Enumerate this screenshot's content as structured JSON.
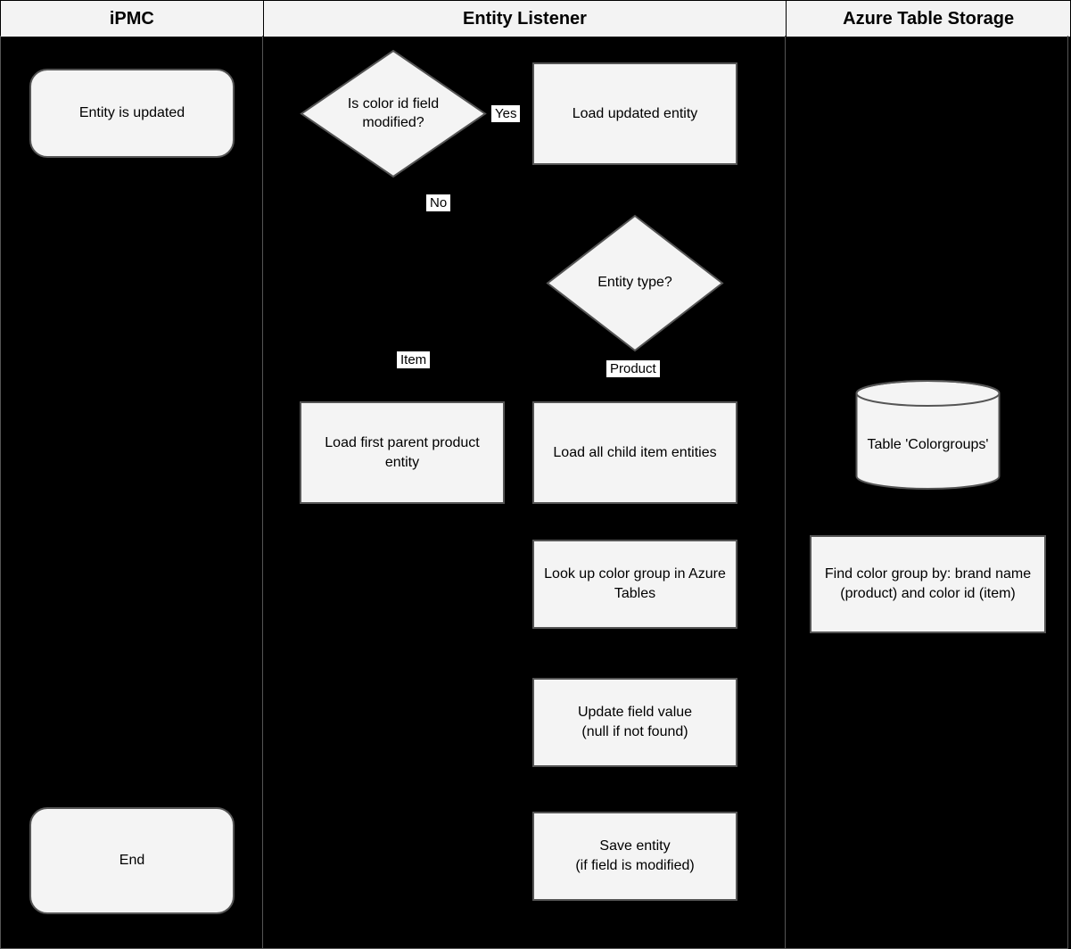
{
  "lanes": {
    "ipmc": "iPMC",
    "el": "Entity Listener",
    "ats": "Azure Table Storage"
  },
  "nodes": {
    "start": "Entity is updated",
    "decision1": "Is color id field modified?",
    "loadUpdated": "Load updated entity",
    "decision2": "Entity type?",
    "loadParent": "Load first parent product entity",
    "loadChildren": "Load all child item entities",
    "lookup": "Look up color group in Azure Tables",
    "update": "Update field value\n(null if not found)",
    "save": "Save entity\n(if field is modified)",
    "cylinder": "Table 'Colorgroups'",
    "findGroup": "Find color group by: brand name (product) and color id (item)",
    "end": "End"
  },
  "labels": {
    "yes": "Yes",
    "no": "No",
    "item": "Item",
    "product": "Product"
  }
}
